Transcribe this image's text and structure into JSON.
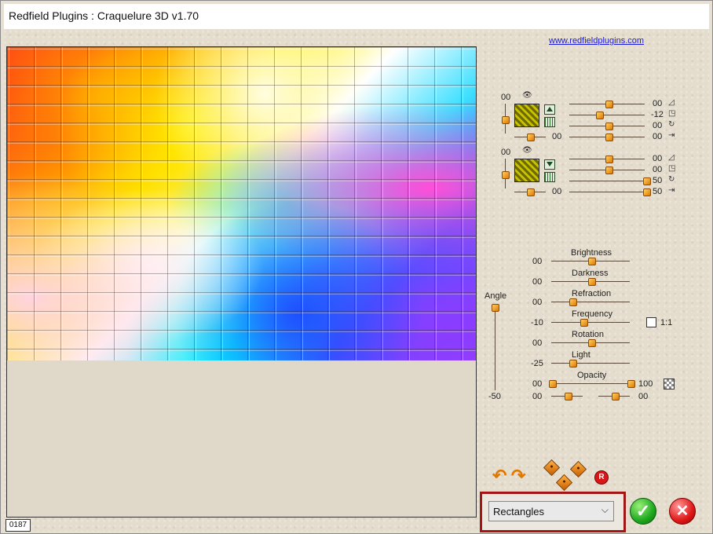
{
  "window": {
    "title": "Redfield Plugins : Craquelure 3D  v1.70",
    "link": "www.redfieldplugins.com",
    "status": "0187"
  },
  "layer1": {
    "top_value": "00",
    "bottom_value": "00",
    "rows": [
      {
        "value": "00",
        "icon": "triangle-ramp-icon"
      },
      {
        "value": "-12",
        "icon": "square-corner-icon"
      },
      {
        "value": "00",
        "icon": "rotate-icon"
      },
      {
        "value": "00",
        "icon": "arrow-right-icon"
      }
    ]
  },
  "layer2": {
    "top_value": "00",
    "bottom_value": "00",
    "rows": [
      {
        "value": "00",
        "icon": "triangle-ramp-icon"
      },
      {
        "value": "00",
        "icon": "square-corner-icon"
      },
      {
        "value": "50",
        "icon": "rotate-icon"
      },
      {
        "value": "50",
        "icon": "arrow-right-icon"
      }
    ]
  },
  "params": {
    "angle_label": "Angle",
    "angle_value": "-50",
    "one_to_one_label": "1:1",
    "sliders": [
      {
        "label": "Brightness",
        "value": "00"
      },
      {
        "label": "Darkness",
        "value": "00"
      },
      {
        "label": "Refraction",
        "value": "00"
      },
      {
        "label": "Frequency",
        "value": "-10"
      },
      {
        "label": "Rotation",
        "value": "00"
      },
      {
        "label": "Light",
        "value": "-25"
      },
      {
        "label": "Opacity",
        "value": "00",
        "value_right": "100"
      }
    ],
    "last_row": {
      "left": "00",
      "right": "00"
    }
  },
  "actions": {
    "random_label": "R",
    "pattern_select": "Rectangles"
  },
  "colors": {
    "accent": "#e07800",
    "highlight_border": "#a31515",
    "ok": "#1fa81f",
    "cancel": "#e01818"
  }
}
